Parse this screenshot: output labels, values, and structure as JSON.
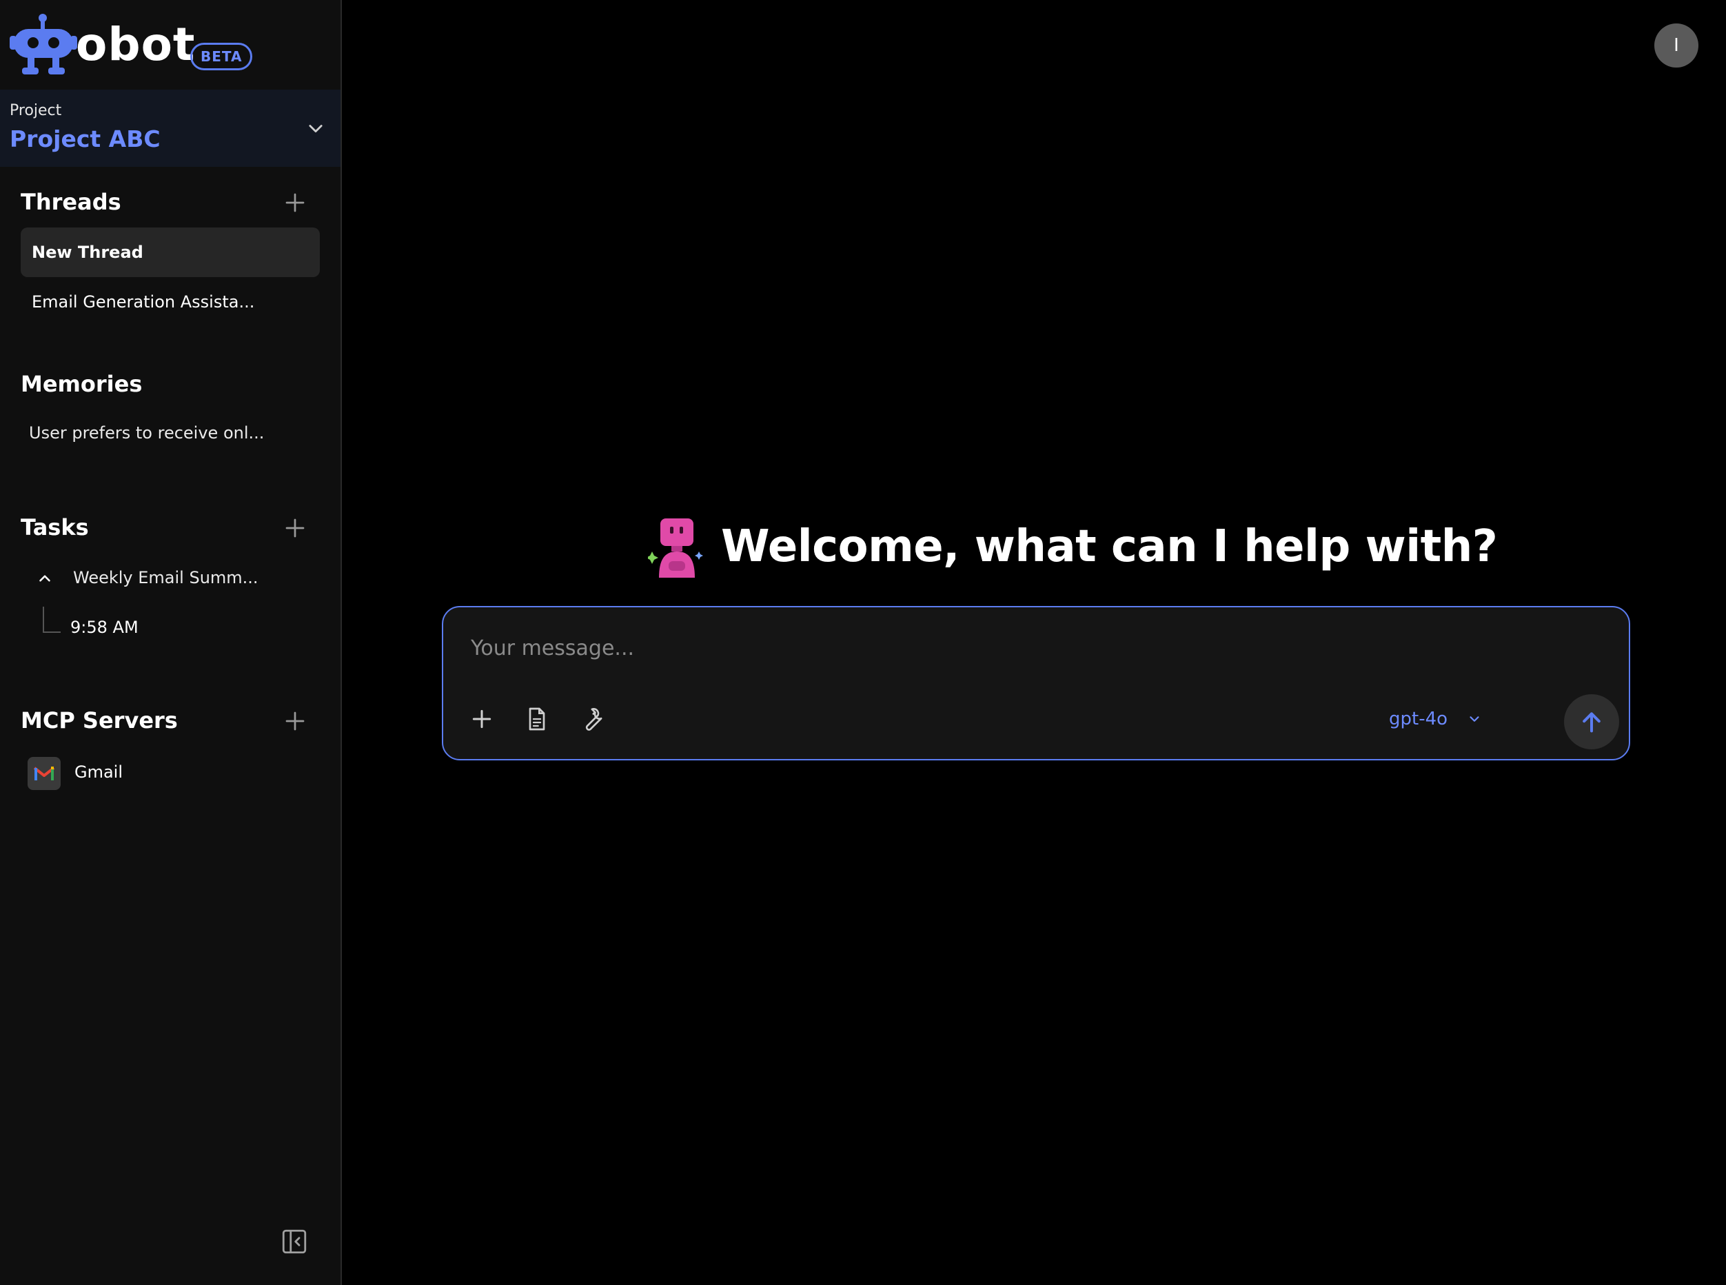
{
  "app": {
    "name": "obot",
    "badge": "BETA"
  },
  "project": {
    "label": "Project",
    "name": "Project ABC"
  },
  "threads": {
    "title": "Threads",
    "items": [
      {
        "label": "New Thread",
        "active": true
      },
      {
        "label": "Email Generation Assista..."
      }
    ]
  },
  "memories": {
    "title": "Memories",
    "items": [
      {
        "label": "User prefers to receive onl..."
      }
    ]
  },
  "tasks": {
    "title": "Tasks",
    "items": [
      {
        "label": "Weekly Email Summ...",
        "runs": [
          "9:58 AM"
        ]
      }
    ]
  },
  "mcp_servers": {
    "title": "MCP Servers",
    "items": [
      {
        "label": "Gmail",
        "icon": "gmail-icon"
      }
    ]
  },
  "user": {
    "avatar_initial": "I"
  },
  "main": {
    "welcome": "Welcome, what can I help with?",
    "composer": {
      "placeholder": "Your message...",
      "value": "",
      "model": "gpt-4o"
    }
  },
  "colors": {
    "accent": "#6d8bff",
    "accent_border": "#5b7cf0",
    "sidebar_bg": "#0f0f0f",
    "project_bg": "#121722",
    "mascot": "#e04aa8"
  }
}
